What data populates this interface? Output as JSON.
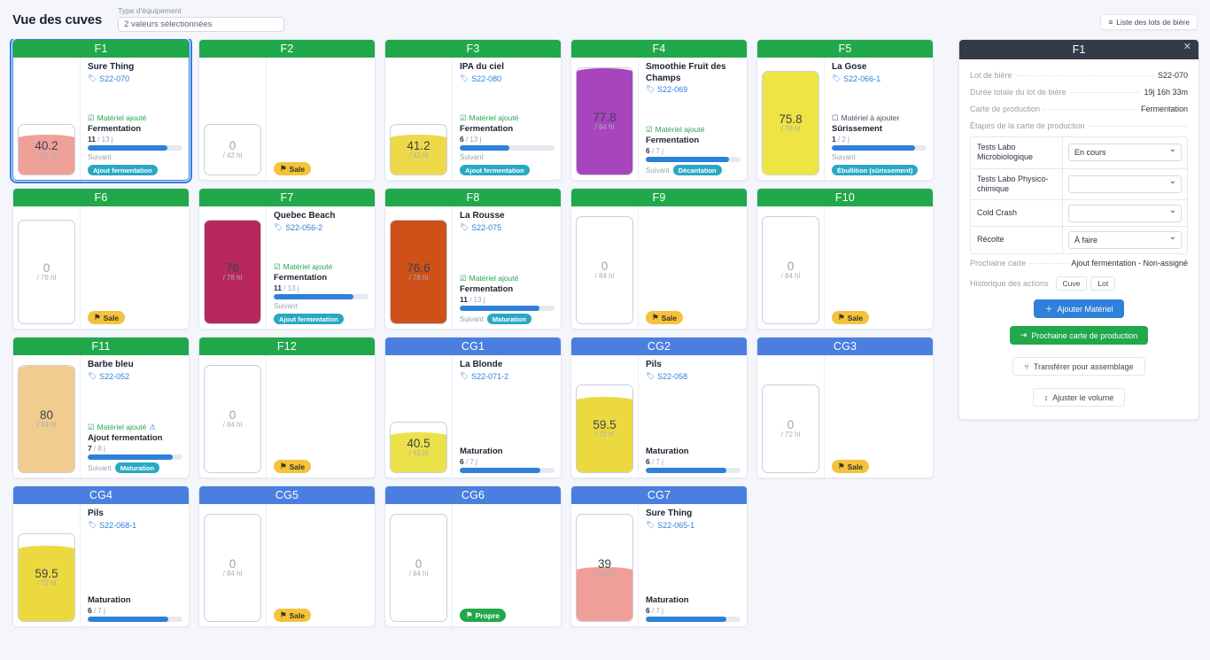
{
  "header": {
    "title": "Vue des cuves",
    "filter_label": "Type d'équipement",
    "filter_value": "2 valeurs sélectionnées",
    "lot_list_button": "Liste des lots de bière",
    "list_icon": "list-icon"
  },
  "tanks": [
    {
      "name": "F1",
      "kind": "ferm",
      "selected": true,
      "volume": "40.2",
      "capacity": "/ 42 hl",
      "fill_pct": 72,
      "liquid_color": "#efa199",
      "beer": "Sure Thing",
      "lot": "S22-070",
      "material": {
        "text": "Matériel ajouté",
        "state": "added",
        "warn": false
      },
      "step": "Fermentation",
      "day_current": "11",
      "day_total": "/ 13 j",
      "progress_pct": 84,
      "next_label": "Suivant",
      "next_value": "Ajout fermentation",
      "badge": null
    },
    {
      "name": "F2",
      "kind": "ferm",
      "selected": false,
      "volume": "0",
      "capacity": "/ 42 hl",
      "fill_pct": 0,
      "liquid_color": "#ffffff",
      "beer": null,
      "lot": null,
      "material": null,
      "step": null,
      "day_current": null,
      "day_total": null,
      "progress_pct": null,
      "next_label": null,
      "next_value": null,
      "badge": {
        "text": "Sale",
        "state": "dirty",
        "icon": "flag-icon"
      }
    },
    {
      "name": "F3",
      "kind": "ferm",
      "selected": false,
      "volume": "41.2",
      "capacity": "/ 42 hl",
      "fill_pct": 72,
      "liquid_color": "#efd949",
      "beer": "IPA du ciel",
      "lot": "S22-080",
      "material": {
        "text": "Matériel ajouté",
        "state": "added",
        "warn": false
      },
      "step": "Fermentation",
      "day_current": "6",
      "day_total": "/ 13 j",
      "progress_pct": 52,
      "next_label": "Suivant",
      "next_value": "Ajout fermentation",
      "badge": null
    },
    {
      "name": "F4",
      "kind": "ferm",
      "selected": false,
      "volume": "77.8",
      "capacity": "/ 84 hl",
      "fill_pct": 96,
      "liquid_color": "#a845bd",
      "beer": "Smoothie Fruit des Champs",
      "lot": "S22-069",
      "material": {
        "text": "Matériel ajouté",
        "state": "added",
        "warn": false
      },
      "step": "Fermentation",
      "day_current": "6",
      "day_total": "/ 7 j",
      "progress_pct": 88,
      "next_label": "Suivant",
      "next_value": "Décantation",
      "badge": null
    },
    {
      "name": "F5",
      "kind": "ferm",
      "selected": false,
      "volume": "75.8",
      "capacity": "/ 78 hl",
      "fill_pct": 97,
      "liquid_color": "#eee444",
      "beer": "La Gose",
      "lot": "S22-066-1",
      "material": {
        "text": "Matériel à ajouter",
        "state": "todo",
        "warn": false
      },
      "step": "Sûrissement",
      "day_current": "1",
      "day_total": "/ 2 j",
      "progress_pct": 88,
      "next_label": "Suivant",
      "next_value": "Ébullition (sûrissement)",
      "badge": null
    },
    {
      "name": "F6",
      "kind": "ferm",
      "selected": false,
      "volume": "0",
      "capacity": "/ 78 hl",
      "fill_pct": 0,
      "liquid_color": "#ffffff",
      "beer": null,
      "lot": null,
      "material": null,
      "step": null,
      "day_current": null,
      "day_total": null,
      "progress_pct": null,
      "next_label": null,
      "next_value": null,
      "badge": {
        "text": "Sale",
        "state": "dirty",
        "icon": "flag-icon"
      }
    },
    {
      "name": "F7",
      "kind": "ferm",
      "selected": false,
      "volume": "76",
      "capacity": "/ 78 hl",
      "fill_pct": 97,
      "liquid_color": "#b8275c",
      "beer": "Quebec Beach",
      "lot": "S22-056-2",
      "material": {
        "text": "Matériel ajouté",
        "state": "added",
        "warn": false
      },
      "step": "Fermentation",
      "day_current": "11",
      "day_total": "/ 13 j",
      "progress_pct": 84,
      "next_label": "Suivant",
      "next_value": "Ajout fermentation",
      "badge": null
    },
    {
      "name": "F8",
      "kind": "ferm",
      "selected": false,
      "volume": "76.6",
      "capacity": "/ 78 hl",
      "fill_pct": 97,
      "liquid_color": "#cf5018",
      "beer": "La Rousse",
      "lot": "S22-075",
      "material": {
        "text": "Matériel ajouté",
        "state": "added",
        "warn": false
      },
      "step": "Fermentation",
      "day_current": "11",
      "day_total": "/ 13 j",
      "progress_pct": 84,
      "next_label": "Suivant",
      "next_value": "Maturation",
      "badge": null
    },
    {
      "name": "F9",
      "kind": "ferm",
      "selected": false,
      "volume": "0",
      "capacity": "/ 84 hl",
      "fill_pct": 0,
      "liquid_color": "#ffffff",
      "beer": null,
      "lot": null,
      "material": null,
      "step": null,
      "day_current": null,
      "day_total": null,
      "progress_pct": null,
      "next_label": null,
      "next_value": null,
      "badge": {
        "text": "Sale",
        "state": "dirty",
        "icon": "flag-icon"
      }
    },
    {
      "name": "F10",
      "kind": "ferm",
      "selected": false,
      "volume": "0",
      "capacity": "/ 84 hl",
      "fill_pct": 0,
      "liquid_color": "#ffffff",
      "beer": null,
      "lot": null,
      "material": null,
      "step": null,
      "day_current": null,
      "day_total": null,
      "progress_pct": null,
      "next_label": null,
      "next_value": null,
      "badge": {
        "text": "Sale",
        "state": "dirty",
        "icon": "flag-icon"
      }
    },
    {
      "name": "F11",
      "kind": "ferm",
      "selected": false,
      "volume": "80",
      "capacity": "/ 84 hl",
      "fill_pct": 97,
      "liquid_color": "#f0cc8f",
      "beer": "Barbe bleu",
      "lot": "S22-052",
      "material": {
        "text": "Matériel ajouté",
        "state": "added",
        "warn": true
      },
      "step": "Ajout fermentation",
      "day_current": "7",
      "day_total": "/ 8 j",
      "progress_pct": 90,
      "next_label": "Suivant",
      "next_value": "Maturation",
      "badge": null
    },
    {
      "name": "F12",
      "kind": "ferm",
      "selected": false,
      "volume": "0",
      "capacity": "/ 84 hl",
      "fill_pct": 0,
      "liquid_color": "#ffffff",
      "beer": null,
      "lot": null,
      "material": null,
      "step": null,
      "day_current": null,
      "day_total": null,
      "progress_pct": null,
      "next_label": null,
      "next_value": null,
      "badge": {
        "text": "Sale",
        "state": "dirty",
        "icon": "flag-icon"
      }
    },
    {
      "name": "CG1",
      "kind": "bright",
      "selected": false,
      "volume": "40.5",
      "capacity": "/ 42 hl",
      "fill_pct": 72,
      "liquid_color": "#ebe14a",
      "beer": "La Blonde",
      "lot": "S22-071-2",
      "material": null,
      "step": "Maturation",
      "day_current": "6",
      "day_total": "/ 7 j",
      "progress_pct": 85,
      "next_label": null,
      "next_value": null,
      "badge": null
    },
    {
      "name": "CG2",
      "kind": "bright",
      "selected": false,
      "volume": "59.5",
      "capacity": "/ 72 hl",
      "fill_pct": 82,
      "liquid_color": "#ecd940",
      "beer": "Pils",
      "lot": "S22-058",
      "material": null,
      "step": "Maturation",
      "day_current": "6",
      "day_total": "/ 7 j",
      "progress_pct": 85,
      "next_label": null,
      "next_value": null,
      "badge": null
    },
    {
      "name": "CG3",
      "kind": "bright",
      "selected": false,
      "volume": "0",
      "capacity": "/ 72 hl",
      "fill_pct": 0,
      "liquid_color": "#ffffff",
      "beer": null,
      "lot": null,
      "material": null,
      "step": null,
      "day_current": null,
      "day_total": null,
      "progress_pct": null,
      "next_label": null,
      "next_value": null,
      "badge": {
        "text": "Sale",
        "state": "dirty",
        "icon": "flag-icon"
      }
    },
    {
      "name": "CG4",
      "kind": "bright",
      "selected": false,
      "volume": "59.5",
      "capacity": "/ 72 hl",
      "fill_pct": 82,
      "liquid_color": "#ecd940",
      "beer": "Pils",
      "lot": "S22-068-1",
      "material": null,
      "step": "Maturation",
      "day_current": "6",
      "day_total": "/ 7 j",
      "progress_pct": 85,
      "next_label": null,
      "next_value": null,
      "badge": null
    },
    {
      "name": "CG5",
      "kind": "bright",
      "selected": false,
      "volume": "0",
      "capacity": "/ 84 hl",
      "fill_pct": 0,
      "liquid_color": "#ffffff",
      "beer": null,
      "lot": null,
      "material": null,
      "step": null,
      "day_current": null,
      "day_total": null,
      "progress_pct": null,
      "next_label": null,
      "next_value": null,
      "badge": {
        "text": "Sale",
        "state": "dirty",
        "icon": "flag-icon"
      }
    },
    {
      "name": "CG6",
      "kind": "bright",
      "selected": false,
      "volume": "0",
      "capacity": "/ 84 hl",
      "fill_pct": 0,
      "liquid_color": "#ffffff",
      "beer": null,
      "lot": null,
      "material": null,
      "step": null,
      "day_current": null,
      "day_total": null,
      "progress_pct": null,
      "next_label": null,
      "next_value": null,
      "badge": {
        "text": "Propre",
        "state": "clean",
        "icon": "flag-icon"
      }
    },
    {
      "name": "CG7",
      "kind": "bright",
      "selected": false,
      "volume": "39",
      "capacity": "/ 84 hl",
      "fill_pct": 47,
      "liquid_color": "#ef9f97",
      "beer": "Sure Thing",
      "lot": "S22-065-1",
      "material": null,
      "step": "Maturation",
      "day_current": "6",
      "day_total": "/ 7 j",
      "progress_pct": 85,
      "next_label": null,
      "next_value": null,
      "badge": null
    }
  ],
  "panel": {
    "title": "F1",
    "close_icon": "close-icon",
    "rows": [
      {
        "key": "Lot de bière",
        "value": "S22-070"
      },
      {
        "key": "Durée totale du lot de bière",
        "value": "19j 16h 33m"
      },
      {
        "key": "Carte de production",
        "value": "Fermentation"
      }
    ],
    "steps_header": "Étapes de la carte de production",
    "steps": [
      {
        "label": "Tests Labo Microbiologique",
        "value": "En cours"
      },
      {
        "label": "Tests Labo Physico-chimique",
        "value": ""
      },
      {
        "label": "Cold Crash",
        "value": ""
      },
      {
        "label": "Récolte",
        "value": "À faire"
      }
    ],
    "next_card": {
      "key": "Prochaine carte",
      "value": "Ajout fermentation - Non-assigné"
    },
    "history": {
      "key": "Historique des actions",
      "btn_tank": "Cuve",
      "btn_lot": "Lot"
    },
    "actions": [
      {
        "label": "Ajouter Matériel",
        "style": "blue",
        "icon": "plus-icon"
      },
      {
        "label": "Prochaine carte de production",
        "style": "green",
        "icon": "arrow-right-icon"
      },
      {
        "label": "Transférer pour assemblage",
        "style": "ghost",
        "icon": "branch-icon"
      },
      {
        "label": "Ajuster le volume",
        "style": "ghost",
        "icon": "vertical-bar-icon"
      }
    ]
  },
  "colors": {
    "ferm_header": "#21a84b",
    "bright_header": "#4a7fe0",
    "progress": "#2f80d8",
    "pill": "#29a8c4",
    "dirty": "#f5c23c",
    "clean": "#21a84b",
    "panel_header": "#343b48",
    "page_bg": "#f4f6fb"
  }
}
